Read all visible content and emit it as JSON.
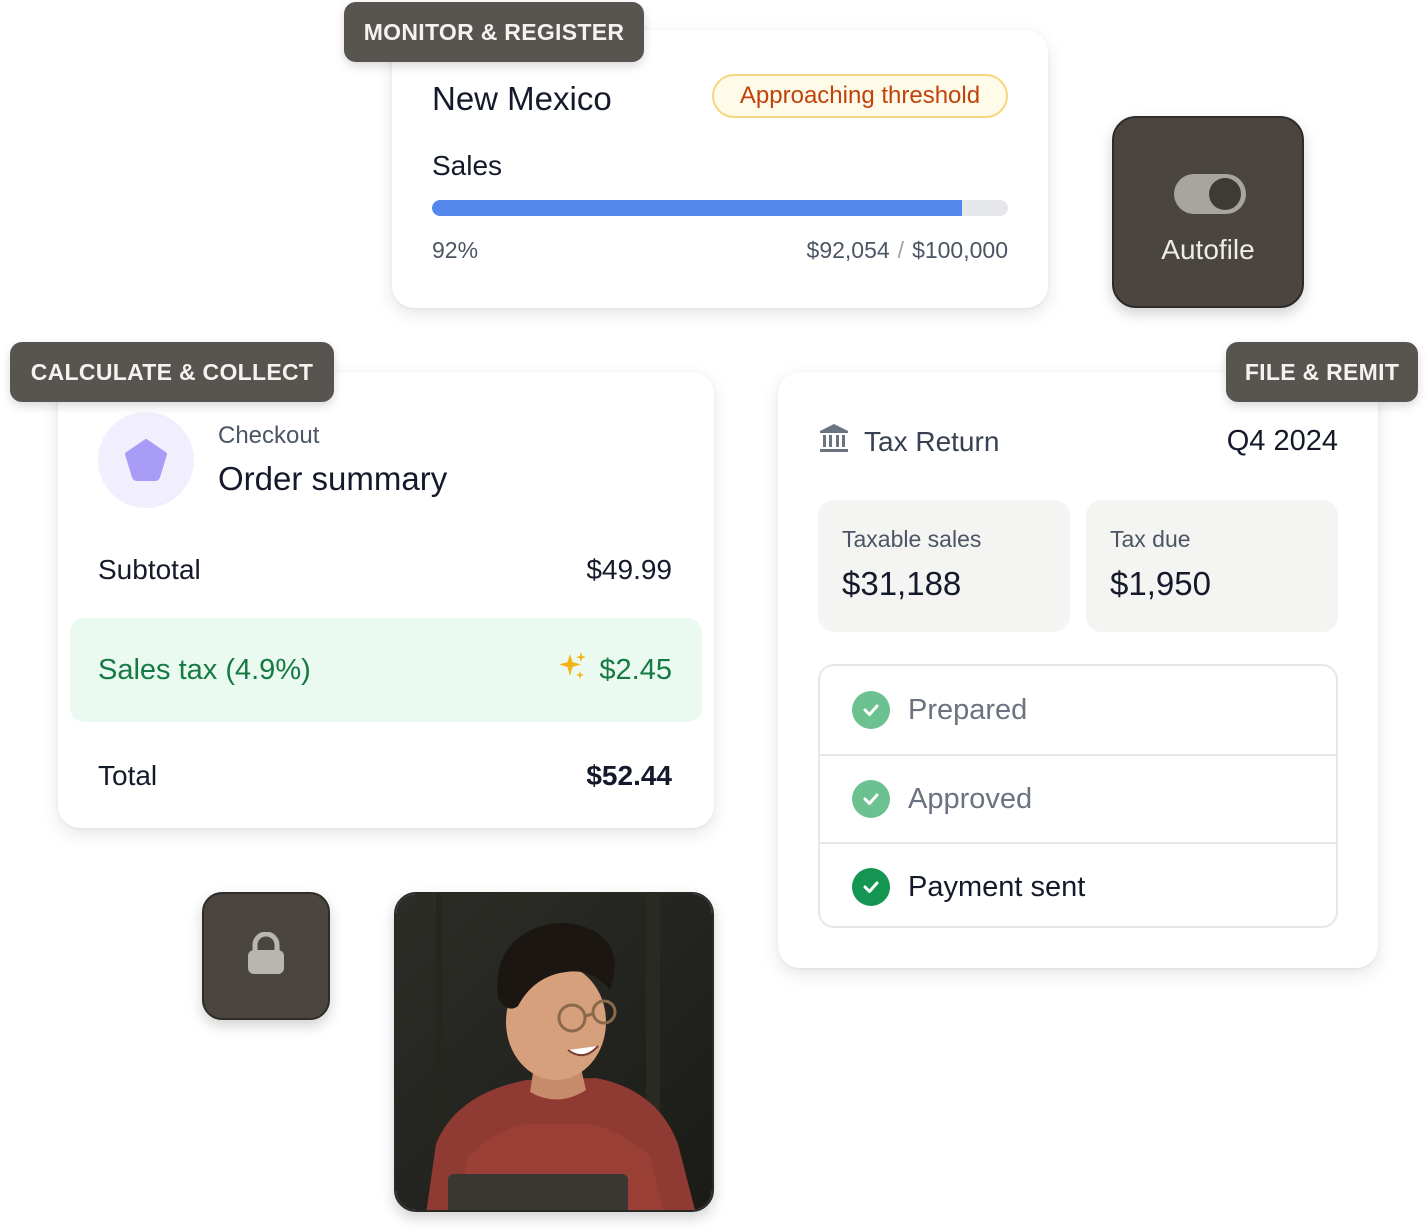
{
  "tags": {
    "monitor": "MONITOR & REGISTER",
    "calculate": "CALCULATE & COLLECT",
    "file": "FILE & REMIT"
  },
  "monitor": {
    "state": "New Mexico",
    "badge": "Approaching threshold",
    "sales_label": "Sales",
    "progress_fraction": 0.92,
    "percent_text": "92%",
    "current": "$92,054",
    "separator": "/",
    "threshold": "$100,000",
    "progress_color": "#5387ec"
  },
  "autofile": {
    "label": "Autofile",
    "toggle_on": true
  },
  "order": {
    "overline": "Checkout",
    "title": "Order summary",
    "subtotal_label": "Subtotal",
    "subtotal_value": "$49.99",
    "tax_label": "Sales tax (4.9%)",
    "tax_value": "$2.45",
    "total_label": "Total",
    "total_value": "$52.44",
    "accent": "#157a43"
  },
  "lock": {
    "icon": "lock-icon"
  },
  "photo": {
    "description": "person-photo"
  },
  "tax_return": {
    "title": "Tax Return",
    "period": "Q4 2024",
    "taxable_label": "Taxable sales",
    "taxable_value": "$31,188",
    "due_label": "Tax due",
    "due_value": "$1,950",
    "steps": [
      {
        "label": "Prepared",
        "state": "done-muted"
      },
      {
        "label": "Approved",
        "state": "done-muted"
      },
      {
        "label": "Payment sent",
        "state": "done"
      }
    ]
  }
}
